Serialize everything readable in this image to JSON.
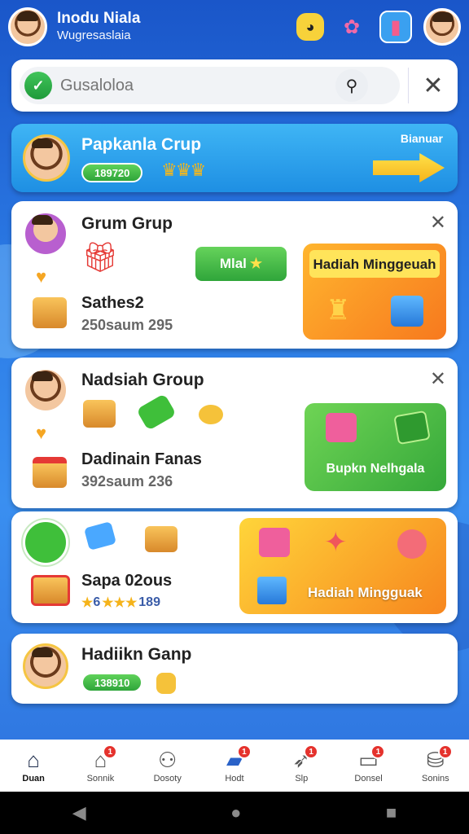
{
  "header": {
    "name": "Inodu Niala",
    "subtitle": "Wugresaslaia",
    "icons": [
      "game-controller-icon",
      "gift-icon",
      "shop-icon",
      "profile-avatar"
    ]
  },
  "search": {
    "placeholder": "Gusaloloa",
    "search_icon": "magnifier-icon",
    "close_icon": "close-icon"
  },
  "banner": {
    "title": "Papkanla Crup",
    "points": "189720",
    "side_label": "Bianuar"
  },
  "groups": [
    {
      "name": "Grum Grup",
      "badge": "Mlal",
      "item_label": "Sathes2",
      "stats": "250saum 295",
      "prize": "Hadiah Minggeuah"
    },
    {
      "name": "Nadsiah Group",
      "item_label": "Dadinain Fanas",
      "stats": "392saum 236",
      "prize": "Bupkn Nelhgala"
    },
    {
      "item_label": "Sapa 02ous",
      "stats": "6",
      "stats2": "189",
      "prize": "Hadiah Mingguak"
    },
    {
      "name": "Hadiikn Ganp",
      "points": "138910"
    }
  ],
  "nav": [
    {
      "label": "Duan",
      "icon": "home-icon",
      "badge": ""
    },
    {
      "label": "Sonnik",
      "icon": "store-icon",
      "badge": "1"
    },
    {
      "label": "Dosoty",
      "icon": "person-icon",
      "badge": ""
    },
    {
      "label": "Hodt",
      "icon": "card-icon",
      "badge": "1"
    },
    {
      "label": "Slp",
      "icon": "send-icon",
      "badge": "1"
    },
    {
      "label": "Donsel",
      "icon": "message-icon",
      "badge": "1"
    },
    {
      "label": "Sonins",
      "icon": "settings-icon",
      "badge": "1"
    }
  ],
  "colors": {
    "background": "#2c7ce6",
    "banner": "#1e8fe3",
    "prize_orange": "#f7931e",
    "prize_green": "#4fbf3a",
    "badge_red": "#e5322d"
  }
}
